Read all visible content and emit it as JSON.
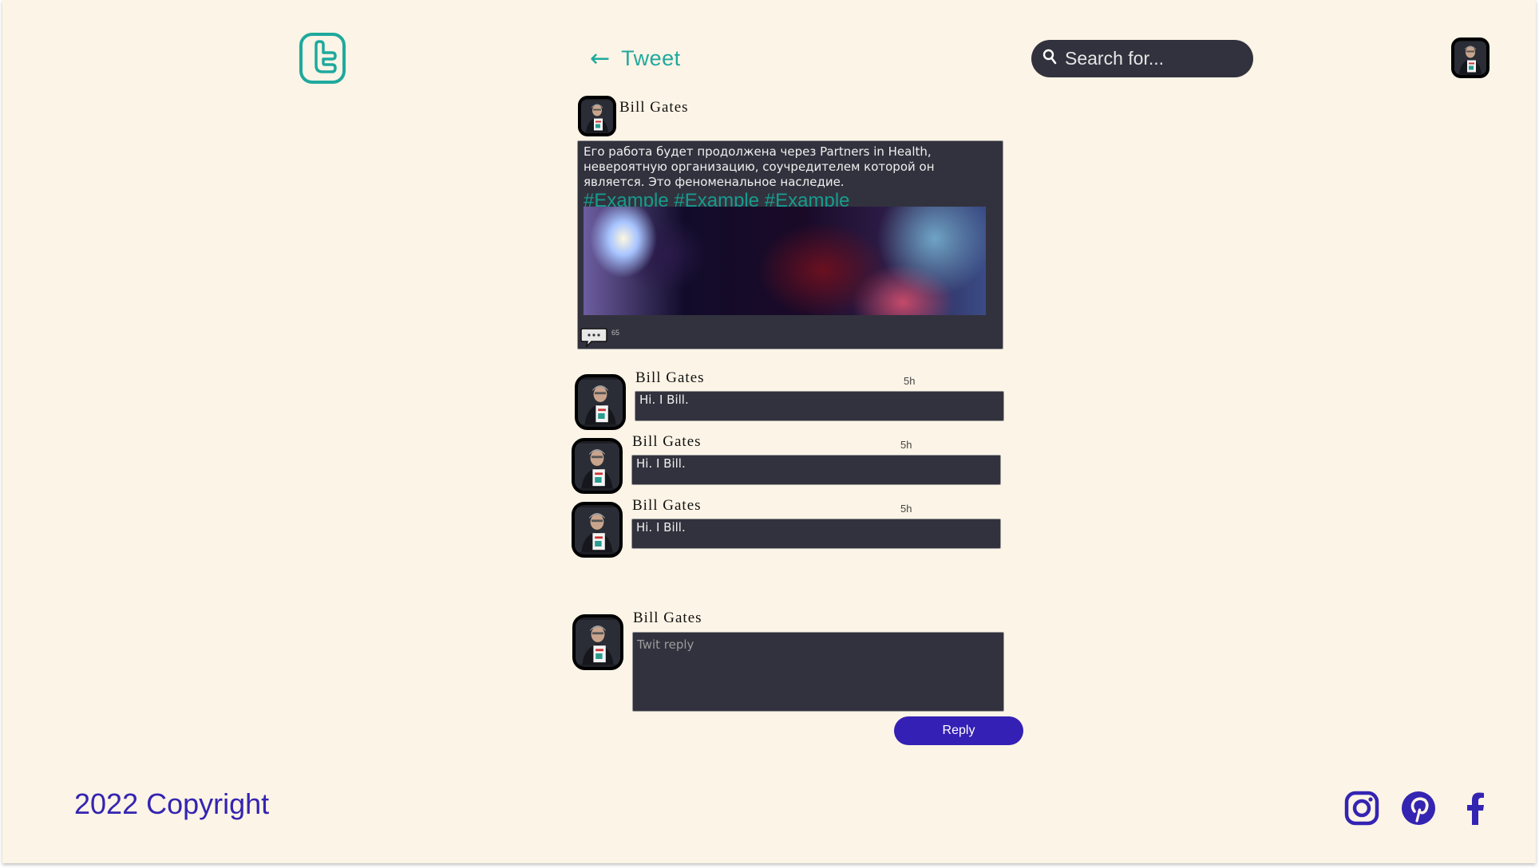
{
  "header": {
    "back_arrow": "←",
    "back_label": "Tweet",
    "search_placeholder": "Search for..."
  },
  "tweet": {
    "author": "Bill Gates",
    "text": "Его работа будет продолжена через Partners in Health, невероятную организацию, соучредителем которой он является. Это феноменальное наследие.",
    "hashtags": "#Example #Example #Example",
    "comment_count": "65"
  },
  "replies": [
    {
      "author": "Bill Gates",
      "time": "5h",
      "text": "Hi. I Bill."
    },
    {
      "author": "Bill Gates",
      "time": "5h",
      "text": "Hi. I Bill."
    },
    {
      "author": "Bill Gates",
      "time": "5h",
      "text": "Hi. I Bill."
    }
  ],
  "compose": {
    "author": "Bill Gates",
    "placeholder": "Twit reply",
    "button_label": "Reply"
  },
  "footer": {
    "copyright": "2022 Copyright",
    "social": [
      "instagram-icon",
      "pinterest-icon",
      "facebook-icon"
    ]
  },
  "colors": {
    "background": "#fcf4e6",
    "accent_teal": "#1fa99d",
    "card": "#32323e",
    "primary_purple": "#3420b4"
  }
}
